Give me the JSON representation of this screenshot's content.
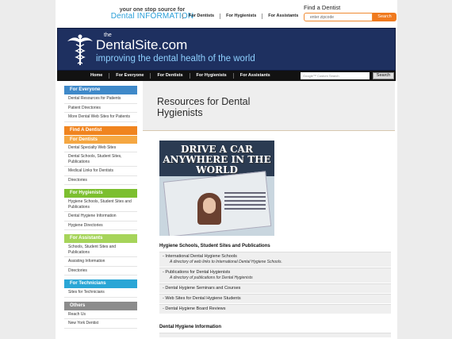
{
  "header": {
    "tagline_top": "your one stop source for",
    "tagline_bottom": "Dental INFORMATION",
    "nav": [
      "For Dentists",
      "For Hygienists",
      "For Assistants"
    ],
    "find_title": "Find a Dentist",
    "zip_placeholder": "enter zipcode",
    "search_label": "Search"
  },
  "brand": {
    "the": "the",
    "name": "DentalSite.com",
    "subtitle": "improving the dental health of the world"
  },
  "navbar": {
    "items": [
      "Home",
      "For Everyone",
      "For Dentists",
      "For Hygienists",
      "For Assistants"
    ],
    "search_placeholder": "Google™ Custom Search",
    "search_button": "Search"
  },
  "sidebar": {
    "everyone": {
      "title": "For Everyone",
      "links": [
        "Dental Resources for Patients",
        "Patient Directories",
        "More Dental Web Sites for Patients"
      ]
    },
    "find_dentist": "Find A Dentist",
    "dentists": {
      "title": "For Dentists",
      "links": [
        "Dental Specialty Web Sites",
        "Dental Schools, Student Sites, Publications",
        "Medical Links for Dentists",
        "Directories"
      ]
    },
    "hygienists": {
      "title": "For Hygienists",
      "links": [
        "Hygiene Schools, Student Sites and Publications",
        "Dental Hygiene Information",
        "Hygiene Directories"
      ]
    },
    "assistants": {
      "title": "For Assistants",
      "links": [
        "Schools, Student Sites and Publications",
        "Assisting Information",
        "Directories"
      ]
    },
    "technicians": {
      "title": "For Technicians",
      "links": [
        "Sites for Technicians"
      ]
    },
    "others": {
      "title": "Others",
      "links": [
        "Reach Us",
        "New York Dentist"
      ]
    }
  },
  "main": {
    "title": "Resources for Dental Hygienists",
    "ad": {
      "headline": "DRIVE A CAR ANYWHERE IN THE WORLD"
    },
    "section1": {
      "title": "Hygiene Schools, Student Sites and Publications",
      "items": [
        {
          "label": "- International Dental Hygiene Schools",
          "desc": "A directory of web links to International Dental Hygiene Schools."
        },
        {
          "label": "- Publications for Dental Hygienists",
          "desc": "A directory of publications for Dental Hygienists"
        },
        {
          "label": "- Dental Hygiene Seminars and Courses",
          "desc": ""
        },
        {
          "label": "- Web Sites for Dental Hygiene Students",
          "desc": ""
        },
        {
          "label": "- Dental Hygiene Board Reviews",
          "desc": ""
        }
      ]
    },
    "section2": {
      "title": "Dental Hygiene Information"
    }
  }
}
